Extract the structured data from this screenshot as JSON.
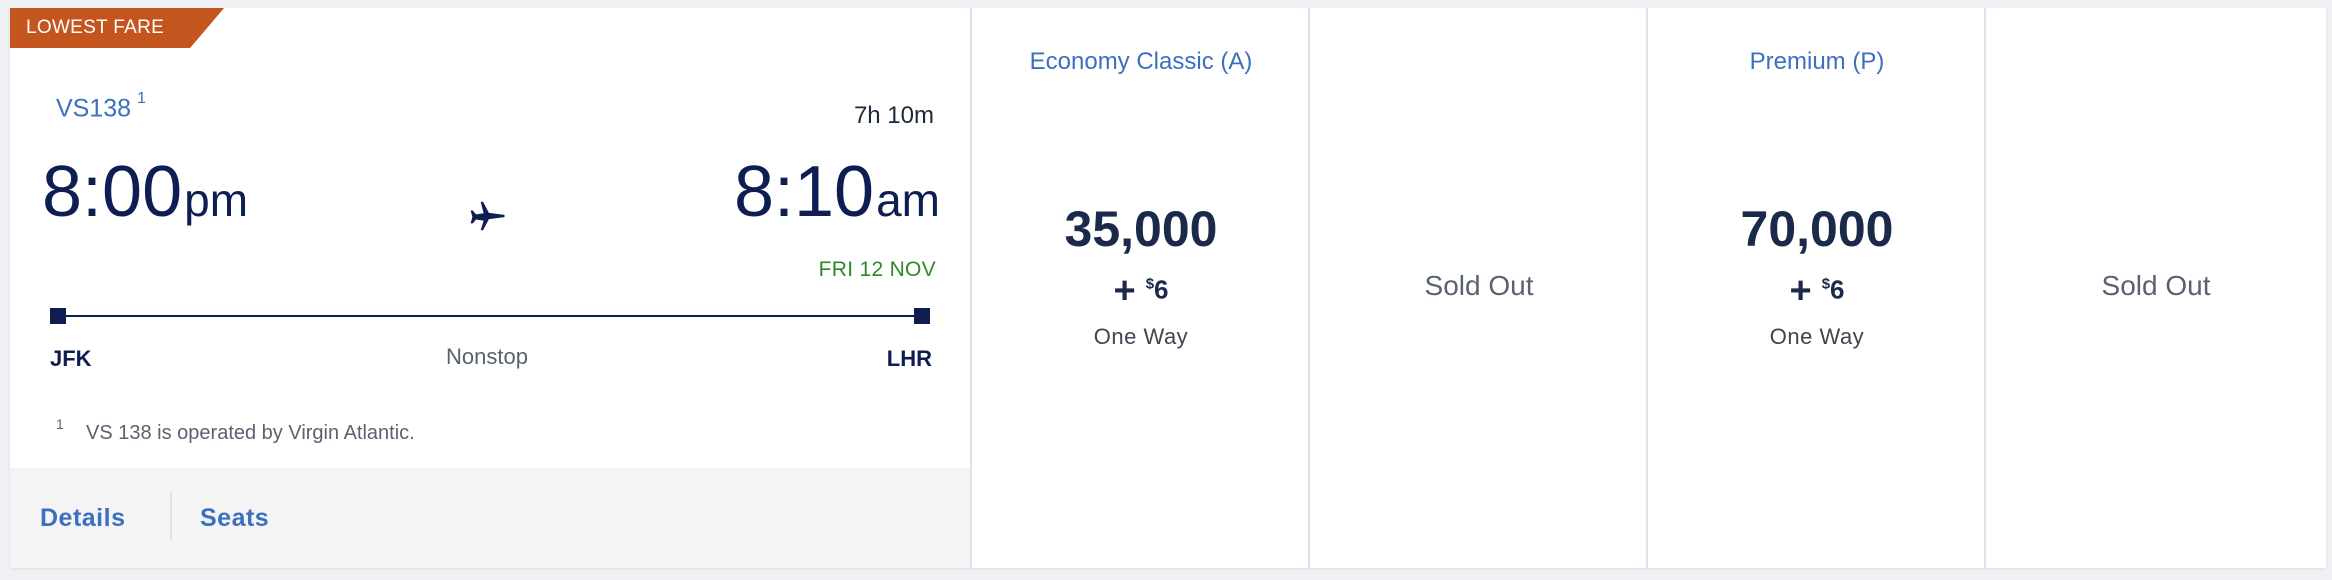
{
  "flight": {
    "badge": "LOWEST FARE",
    "flight_number": "VS138",
    "footnote_marker": "1",
    "duration": "7h 10m",
    "departure": {
      "time": "8:00",
      "ampm": "pm",
      "airport": "JFK"
    },
    "arrival": {
      "time": "8:10",
      "ampm": "am",
      "date": "FRI 12 NOV",
      "airport": "LHR"
    },
    "stops": "Nonstop",
    "footnote_number": "1",
    "footnote_text": "VS 138 is operated by Virgin Atlantic.",
    "plane_icon": "airplane-icon"
  },
  "footer": {
    "details_label": "Details",
    "seats_label": "Seats"
  },
  "fares": [
    {
      "cabin": "Economy Classic (A)",
      "miles": "35,000",
      "plus": "+",
      "currency": "$",
      "tax": "6",
      "trip": "One Way"
    },
    {
      "cabin": "",
      "status": "Sold Out"
    },
    {
      "cabin": "Premium (P)",
      "miles": "70,000",
      "plus": "+",
      "currency": "$",
      "tax": "6",
      "trip": "One Way"
    },
    {
      "cabin": "",
      "status": "Sold Out"
    }
  ],
  "colors": {
    "badge": "#c4551e",
    "link": "#3d6fc1",
    "navy": "#0e1e52",
    "date_green": "#2c8a28"
  }
}
